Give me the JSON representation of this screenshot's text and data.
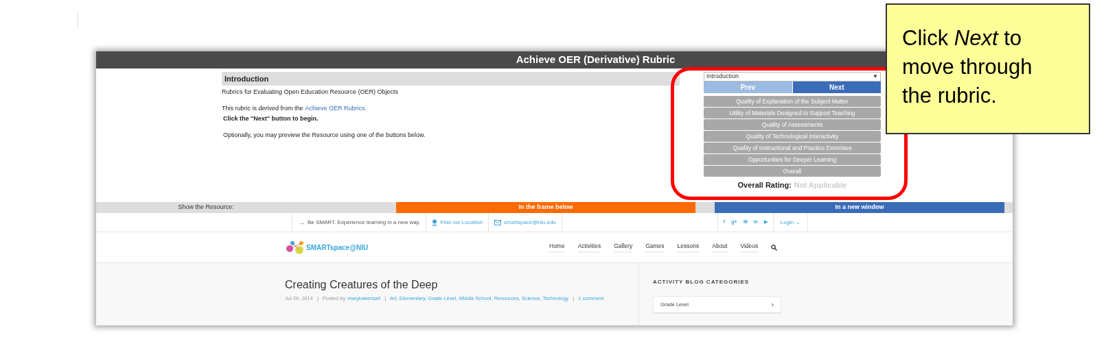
{
  "rubric": {
    "title": "Achieve OER (Derivative) Rubric",
    "section_heading": "Introduction",
    "subtitle": "Rubrics for Evaluating Open Education Resource (OER) Objects",
    "derived_text": "This rubric is derived from the",
    "derived_link": "Achieve OER Rubrics.",
    "instruction": "Click the \"Next\" button to begin.",
    "optional_text": "Optionally, you may preview the Resource using one of the buttons below.",
    "dropdown": {
      "value": "Introduction",
      "arrow": "▼"
    },
    "nav_buttons": [
      {
        "label": "Prev",
        "disabled": true
      },
      {
        "label": "Next",
        "disabled": false
      }
    ],
    "criteria": [
      "Quality of Explanation of the Subject Matter",
      "Utility of Materials Designed to Support Teaching",
      "Quality of Assessments",
      "Quality of Technological Interactivity",
      "Quality of Instructional and Practice Exercises",
      "Opportunities for Deeper Learning",
      "Overall"
    ],
    "overall_label": "Overall Rating:",
    "overall_value": "Not Applicable"
  },
  "resource_bar": {
    "label": "Show the Resource:",
    "buttons": [
      {
        "label": "In the frame below",
        "kind": "primary"
      },
      {
        "label": "In a new window",
        "kind": "secondary"
      }
    ]
  },
  "site": {
    "top_links": [
      {
        "kind": "arrow",
        "icon": "→",
        "label": "Be SMART. Experience learning in a new way."
      },
      {
        "kind": "pin",
        "label": "Find our Location"
      },
      {
        "kind": "mail",
        "label": "smartspace@niu.edu"
      }
    ],
    "social": [
      "f",
      "g+",
      "✉",
      "in",
      "▶"
    ],
    "login": "Login ⌄",
    "logo": "SMARTspace@NIU",
    "menu": [
      "Home",
      "Activities",
      "Gallery",
      "Games",
      "Lessons",
      "About",
      "Videos"
    ],
    "post": {
      "title": "Creating Creatures of the Deep",
      "meta": [
        {
          "kind": "date",
          "text": "Jul 29, 2014"
        },
        {
          "kind": "separator",
          "text": "|"
        },
        {
          "kind": "label",
          "text": "Posted by"
        },
        {
          "kind": "author",
          "text": "marybakersart"
        },
        {
          "kind": "separator",
          "text": "|"
        },
        {
          "kind": "categories",
          "text": "Art, Elementary, Grade Level, Middle School, Resources, Science, Technology"
        },
        {
          "kind": "separator",
          "text": "|"
        },
        {
          "kind": "comments",
          "text": "1 comment"
        }
      ]
    },
    "sidebar": {
      "heading": "ACTIVITY BLOG CATEGORIES",
      "items": [
        {
          "label": "Grade Level",
          "chevron": "›"
        }
      ]
    }
  },
  "callout": {
    "text": "Click *Next* to move through the rubric."
  }
}
